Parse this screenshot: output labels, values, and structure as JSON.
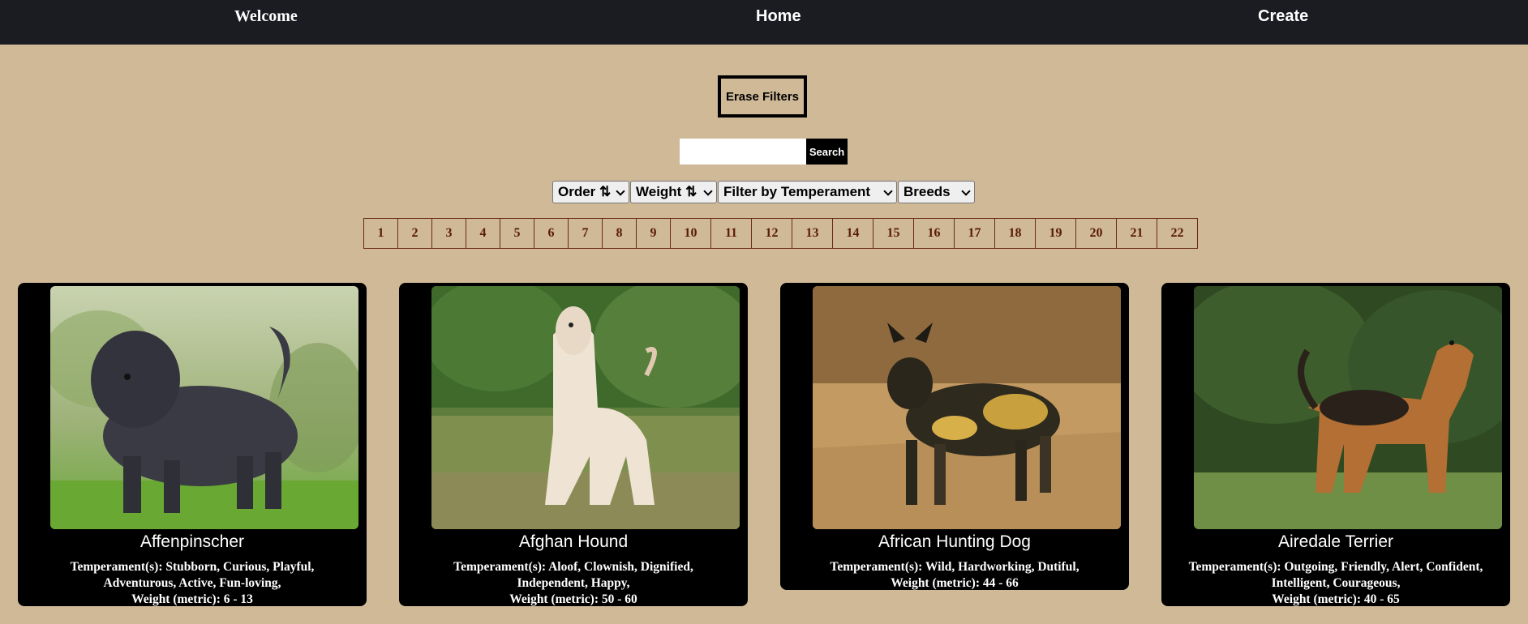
{
  "nav": {
    "welcome": "Welcome",
    "home": "Home",
    "create": "Create"
  },
  "filters": {
    "erase_label": "Erase Filters",
    "search_placeholder": "",
    "search_label": "Search",
    "order_label": "Order ⇅",
    "weight_label": "Weight ⇅",
    "temperament_label": "Filter by Temperament",
    "breeds_label": "Breeds"
  },
  "pagination": [
    "1",
    "2",
    "3",
    "4",
    "5",
    "6",
    "7",
    "8",
    "9",
    "10",
    "11",
    "12",
    "13",
    "14",
    "15",
    "16",
    "17",
    "18",
    "19",
    "20",
    "21",
    "22"
  ],
  "cards": [
    {
      "name": "Affenpinscher",
      "temperament_line1": "Temperament(s): Stubborn, Curious, Playful,",
      "temperament_line2": "Adventurous, Active, Fun-loving,",
      "weight": "Weight (metric): 6 - 13",
      "image": "dog-photo-affenpinscher"
    },
    {
      "name": "Afghan Hound",
      "temperament_line1": "Temperament(s): Aloof, Clownish, Dignified,",
      "temperament_line2": "Independent, Happy,",
      "weight": "Weight (metric): 50 - 60",
      "image": "dog-photo-afghan-hound"
    },
    {
      "name": "African Hunting Dog",
      "temperament_line1": "Temperament(s): Wild, Hardworking, Dutiful,",
      "temperament_line2": "",
      "weight": "Weight (metric): 44 - 66",
      "image": "dog-photo-african-hunting-dog"
    },
    {
      "name": "Airedale Terrier",
      "temperament_line1": "Temperament(s): Outgoing, Friendly, Alert, Confident,",
      "temperament_line2": "Intelligent, Courageous,",
      "weight": "Weight (metric): 40 - 65",
      "image": "dog-photo-airedale-terrier"
    }
  ],
  "colors": {
    "background": "#cfb997",
    "navbar": "#1b1c22",
    "card": "#000000",
    "page_text": "#5a1a08"
  }
}
